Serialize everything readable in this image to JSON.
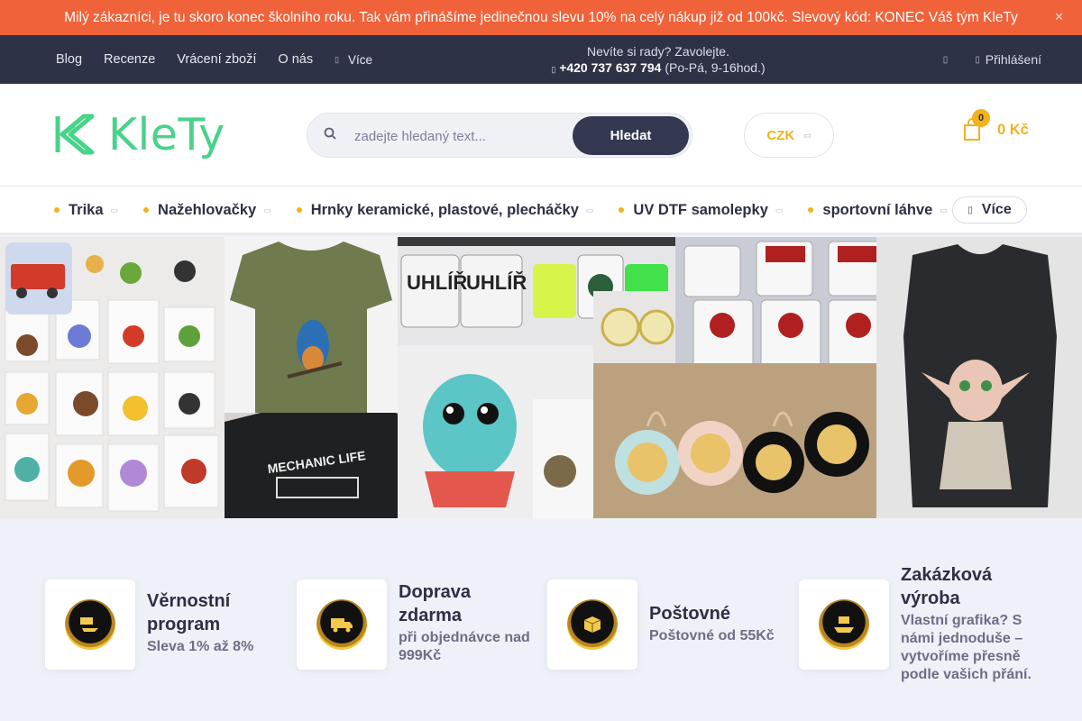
{
  "announcement": {
    "text": "Milý zákazníci, je tu skoro konec školního roku. Tak vám přinášíme jedinečnou slevu 10% na celý nákup již od 100kč. Slevový kód: KONEC Váš tým KleTy",
    "close_icon": "close-icon"
  },
  "topbar": {
    "nav": [
      "Blog",
      "Recenze",
      "Vrácení zboží",
      "O nás"
    ],
    "more_label": "Více",
    "support_line": "Nevíte si rady? Zavolejte.",
    "phone": "+420 737 637 794",
    "hours": "(Po-Pá, 9-16hod.)",
    "login_label": "Přihlášení"
  },
  "header": {
    "logo_text": "KleTy",
    "search_placeholder": "zadejte hledaný text...",
    "search_button": "Hledat",
    "currency": "CZK",
    "cart_count": "0",
    "cart_total": "0 Kč"
  },
  "categories": {
    "items": [
      {
        "label": "Trika"
      },
      {
        "label": "Nažehlovačky"
      },
      {
        "label": "Hrnky keramické, plastové, plecháčky"
      },
      {
        "label": "UV DTF samolepky"
      },
      {
        "label": "sportovní láhve"
      }
    ],
    "more_label": "Více"
  },
  "features": [
    {
      "title": "Věrnostní program",
      "subtitle": "Sleva 1% až 8%",
      "icon": "loyalty-icon"
    },
    {
      "title": "Doprava zdarma",
      "subtitle": "při objednávce nad 999Kč",
      "icon": "truck-icon"
    },
    {
      "title": "Poštovné",
      "subtitle": "Poštovné od 55Kč",
      "icon": "package-icon"
    },
    {
      "title": "Zakázková výroba",
      "subtitle": "Vlastní grafika? S námi jednoduše – vytvoříme přesně podle vašich přání.",
      "icon": "custom-production-icon"
    }
  ],
  "colors": {
    "announcement_bg": "#f0623a",
    "topbar_bg": "#2e3247",
    "brand_green": "#48d28a",
    "accent_yellow": "#f2b21b",
    "button_dark": "#343850"
  }
}
